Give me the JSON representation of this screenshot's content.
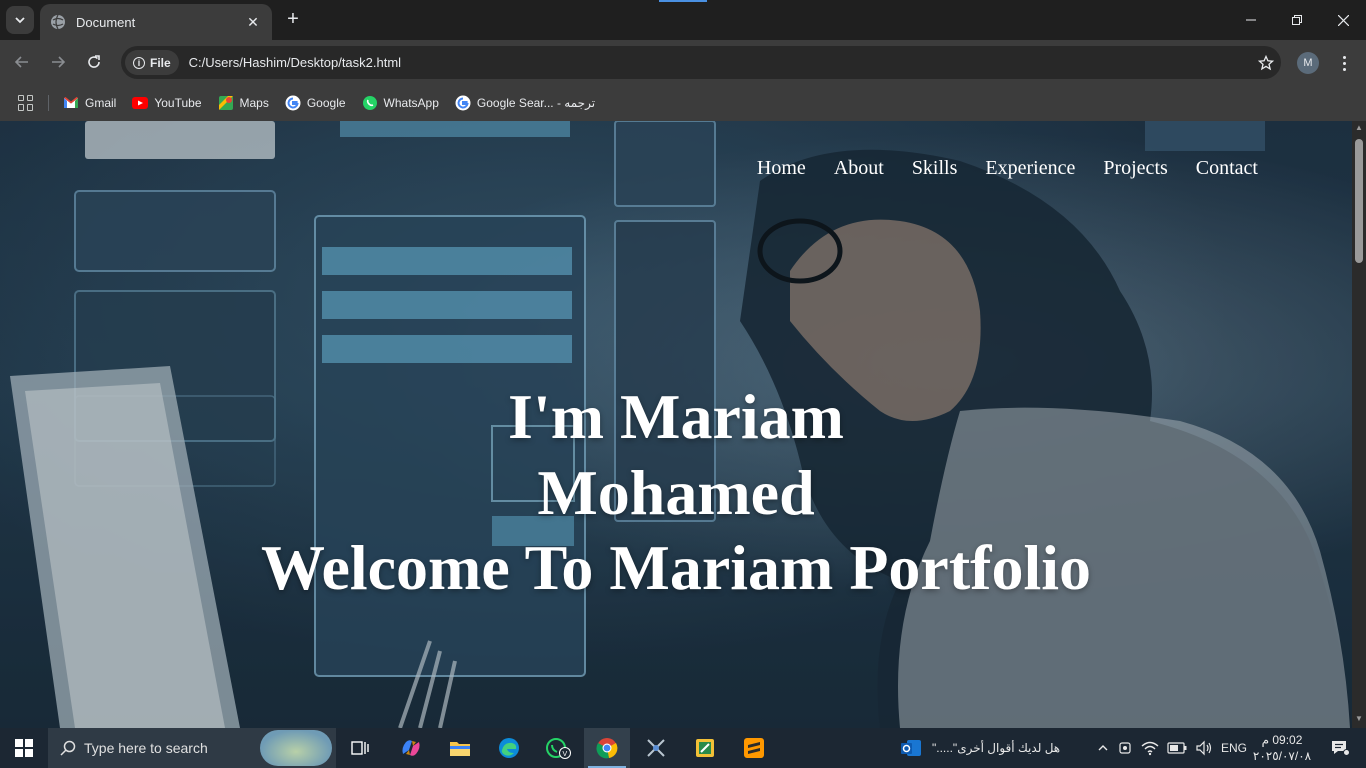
{
  "browser": {
    "tab_title": "Document",
    "url_chip": "File",
    "url": "C:/Users/Hashim/Desktop/task2.html",
    "profile_initial": "M",
    "bookmarks": [
      {
        "label": "Gmail",
        "icon": "gmail-icon"
      },
      {
        "label": "YouTube",
        "icon": "youtube-icon"
      },
      {
        "label": "Maps",
        "icon": "maps-icon"
      },
      {
        "label": "Google",
        "icon": "google-icon"
      },
      {
        "label": "WhatsApp",
        "icon": "whatsapp-icon"
      },
      {
        "label": "Google Sear... - ترجمه",
        "icon": "google-icon"
      }
    ]
  },
  "site": {
    "nav": [
      "Home",
      "About",
      "Skills",
      "Experience",
      "Projects",
      "Contact"
    ],
    "hero_name": "I'm Mariam Mohamed",
    "hero_welcome": "Welcome To Mariam Portfolio"
  },
  "taskbar": {
    "search_placeholder": "Type here to search",
    "news_text": "هل لديك أقوال أخرى\".....\"",
    "language": "ENG",
    "time": "09:02 م",
    "date": "٢٠٢٥/٠٧/٠٨"
  },
  "colors": {
    "chrome_dark": "#1f1f1f",
    "chrome_mid": "#3c3c3c",
    "taskbar": "#1c2733",
    "hero_text": "#ffffff"
  }
}
